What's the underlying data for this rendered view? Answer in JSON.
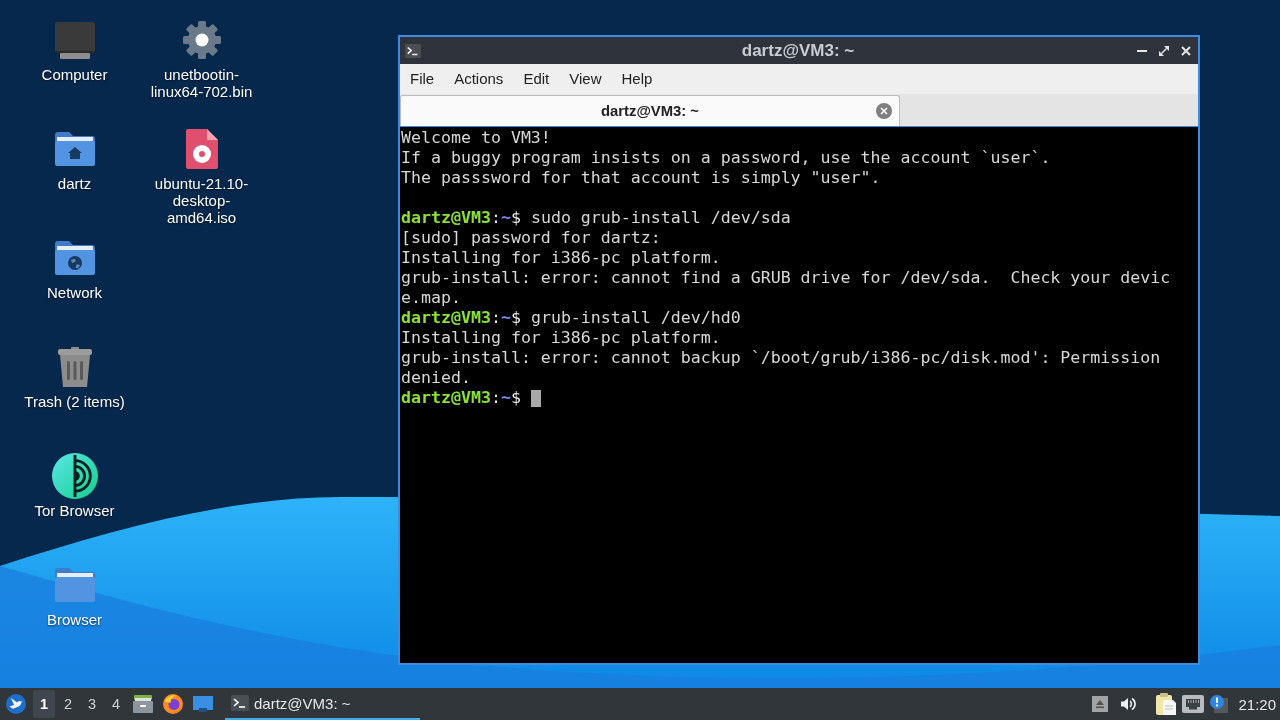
{
  "desktop": {
    "icons": [
      {
        "label": "Computer",
        "kind": "computer"
      },
      {
        "label": "dartz",
        "kind": "home-folder"
      },
      {
        "label": "Network",
        "kind": "network-folder"
      },
      {
        "label": "Trash (2 items)",
        "kind": "trash"
      },
      {
        "label": "Tor Browser",
        "kind": "onion-app"
      },
      {
        "label": "Browser",
        "kind": "folder"
      },
      {
        "label": "unetbootin-linux64-702.bin",
        "kind": "executable"
      },
      {
        "label": "ubuntu-21.10-desktop-amd64.iso",
        "kind": "disc-image"
      }
    ]
  },
  "window": {
    "title": "dartz@VM3: ~",
    "menu": [
      "File",
      "Actions",
      "Edit",
      "View",
      "Help"
    ],
    "tabs": [
      {
        "label": "dartz@VM3: ~",
        "selected": true
      }
    ],
    "terminal": {
      "lines": [
        {
          "kind": "output",
          "text": "Welcome to VM3!"
        },
        {
          "kind": "output",
          "text": "If a buggy program insists on a password, use the account `user`."
        },
        {
          "kind": "output",
          "text": "The passsword for that account is simply \"user\"."
        },
        {
          "kind": "blank"
        },
        {
          "kind": "prompt",
          "user": "dartz@VM3",
          "separator": ":",
          "path": "~",
          "symbol": "$",
          "command": "sudo grub-install /dev/sda",
          "cursor": false
        },
        {
          "kind": "output",
          "text": "[sudo] password for dartz:"
        },
        {
          "kind": "output",
          "text": "Installing for i386-pc platform."
        },
        {
          "kind": "output",
          "text": "grub-install: error: cannot find a GRUB drive for /dev/sda.  Check your devic"
        },
        {
          "kind": "output",
          "text": "e.map."
        },
        {
          "kind": "prompt",
          "user": "dartz@VM3",
          "separator": ":",
          "path": "~",
          "symbol": "$",
          "command": "grub-install /dev/hd0",
          "cursor": false
        },
        {
          "kind": "output",
          "text": "Installing for i386-pc platform."
        },
        {
          "kind": "output",
          "text": "grub-install: error: cannot backup `/boot/grub/i386-pc/disk.mod': Permission"
        },
        {
          "kind": "output",
          "text": "denied."
        },
        {
          "kind": "prompt",
          "user": "dartz@VM3",
          "separator": ":",
          "path": "~",
          "symbol": "$",
          "cursor": true
        }
      ]
    }
  },
  "taskbar": {
    "workspaces": [
      {
        "label": "1",
        "selected": true
      },
      {
        "label": "2",
        "selected": false
      },
      {
        "label": "3",
        "selected": false
      },
      {
        "label": "4",
        "selected": false
      }
    ],
    "tasks": [
      {
        "label": "dartz@VM3: ~",
        "active": true
      }
    ],
    "clock": "21:20"
  }
}
